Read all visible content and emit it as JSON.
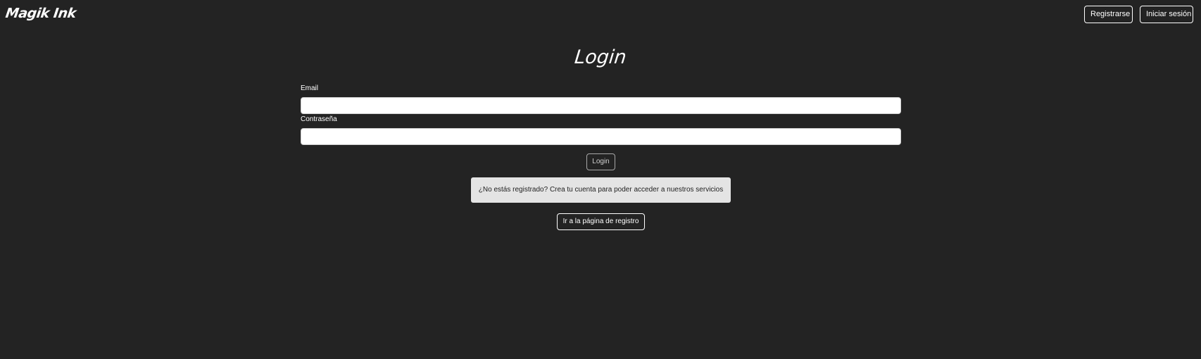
{
  "navbar": {
    "brand": "Magik Ink",
    "register_label": "Registrarse",
    "login_label": "Iniciar sesión"
  },
  "form": {
    "title": "Login",
    "email_label": "Email",
    "email_value": "",
    "password_label": "Contraseña",
    "password_value": "",
    "submit_label": "Login"
  },
  "notice": {
    "text": "¿No estás registrado? Crea tu cuenta para poder acceder a nuestros servicios"
  },
  "register_link": {
    "label": "Ir a la página de registro"
  },
  "colors": {
    "background": "#232323",
    "text": "#ffffff",
    "notice_background": "#e4e4e4"
  }
}
